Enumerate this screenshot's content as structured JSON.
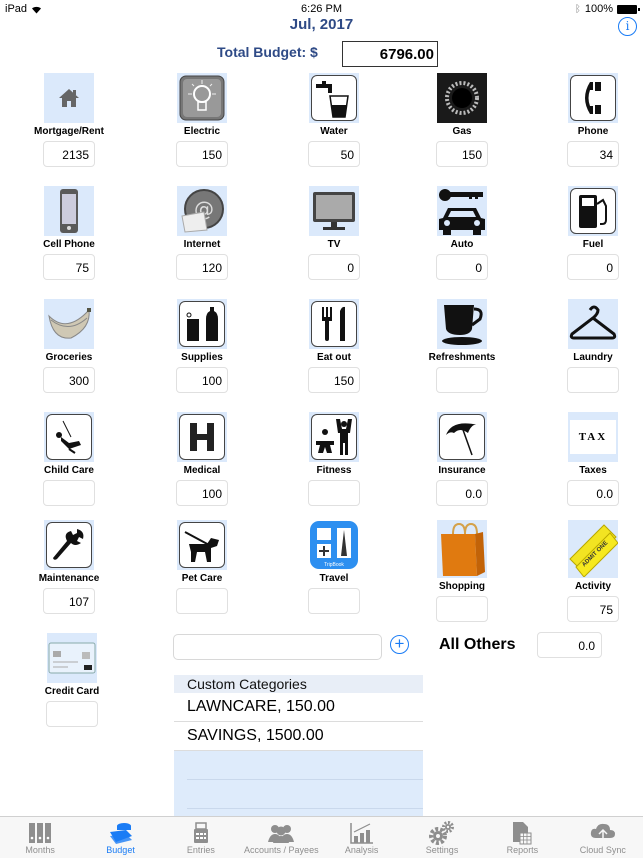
{
  "status_bar": {
    "device": "iPad",
    "time": "6:26 PM",
    "battery": "100%"
  },
  "header": {
    "title": "Jul, 2017",
    "info_icon": "info-icon",
    "total_label": "Total Budget: $",
    "total_value": "6796.00"
  },
  "categories": [
    {
      "label": "Mortgage/Rent",
      "value": "2135",
      "icon": "house-icon"
    },
    {
      "label": "Electric",
      "value": "150",
      "icon": "lightbulb-icon"
    },
    {
      "label": "Water",
      "value": "50",
      "icon": "water-tap-icon"
    },
    {
      "label": "Gas",
      "value": "150",
      "icon": "gas-burner-icon"
    },
    {
      "label": "Phone",
      "value": "34",
      "icon": "phone-icon"
    },
    {
      "label": "Cell Phone",
      "value": "75",
      "icon": "cell-phone-icon"
    },
    {
      "label": "Internet",
      "value": "120",
      "icon": "internet-icon"
    },
    {
      "label": "TV",
      "value": "0",
      "icon": "tv-icon"
    },
    {
      "label": "Auto",
      "value": "0",
      "icon": "car-icon"
    },
    {
      "label": "Fuel",
      "value": "0",
      "icon": "fuel-pump-icon"
    },
    {
      "label": "Groceries",
      "value": "300",
      "icon": "bananas-icon"
    },
    {
      "label": "Supplies",
      "value": "100",
      "icon": "bottles-icon"
    },
    {
      "label": "Eat out",
      "value": "150",
      "icon": "fork-knife-icon"
    },
    {
      "label": "Refreshments",
      "value": "",
      "icon": "cup-icon"
    },
    {
      "label": "Laundry",
      "value": "",
      "icon": "hanger-icon"
    },
    {
      "label": "Child Care",
      "value": "",
      "icon": "swing-icon"
    },
    {
      "label": "Medical",
      "value": "100",
      "icon": "hospital-icon"
    },
    {
      "label": "Fitness",
      "value": "",
      "icon": "fitness-icon"
    },
    {
      "label": "Insurance",
      "value": "0.0",
      "icon": "umbrella-icon"
    },
    {
      "label": "Taxes",
      "value": "0.0",
      "icon": "tax-icon",
      "icon_text": "TAX"
    },
    {
      "label": "Maintenance",
      "value": "107",
      "icon": "wrench-icon"
    },
    {
      "label": "Pet Care",
      "value": "",
      "icon": "dog-icon"
    },
    {
      "label": "Travel",
      "value": "",
      "icon": "travel-icon",
      "icon_text": "TripBook"
    },
    {
      "label": "Shopping",
      "value": "",
      "icon": "shopping-bag-icon"
    },
    {
      "label": "Activity",
      "value": "75",
      "icon": "ticket-icon"
    },
    {
      "label": "Credit Card",
      "value": "",
      "icon": "credit-card-icon"
    }
  ],
  "custom": {
    "input_value": "",
    "add_icon": "plus-circle-icon",
    "header": "Custom Categories",
    "items": [
      "LAWNCARE, 150.00",
      "SAVINGS, 1500.00"
    ]
  },
  "all_others": {
    "label": "All Others",
    "value": "0.0"
  },
  "tabs": [
    {
      "label": "Months",
      "icon": "binders-icon",
      "active": false
    },
    {
      "label": "Budget",
      "icon": "money-stack-icon",
      "active": true
    },
    {
      "label": "Entries",
      "icon": "calculator-icon",
      "active": false
    },
    {
      "label": "Accounts / Payees",
      "icon": "people-icon",
      "active": false
    },
    {
      "label": "Analysis",
      "icon": "bar-chart-icon",
      "active": false
    },
    {
      "label": "Settings",
      "icon": "gears-icon",
      "active": false
    },
    {
      "label": "Reports",
      "icon": "report-icon",
      "active": false
    },
    {
      "label": "Cloud Sync",
      "icon": "cloud-upload-icon",
      "active": false
    }
  ],
  "colors": {
    "accent": "#1a7cf5",
    "title": "#2e4a86",
    "icon_bg": "#dbe9fb"
  }
}
